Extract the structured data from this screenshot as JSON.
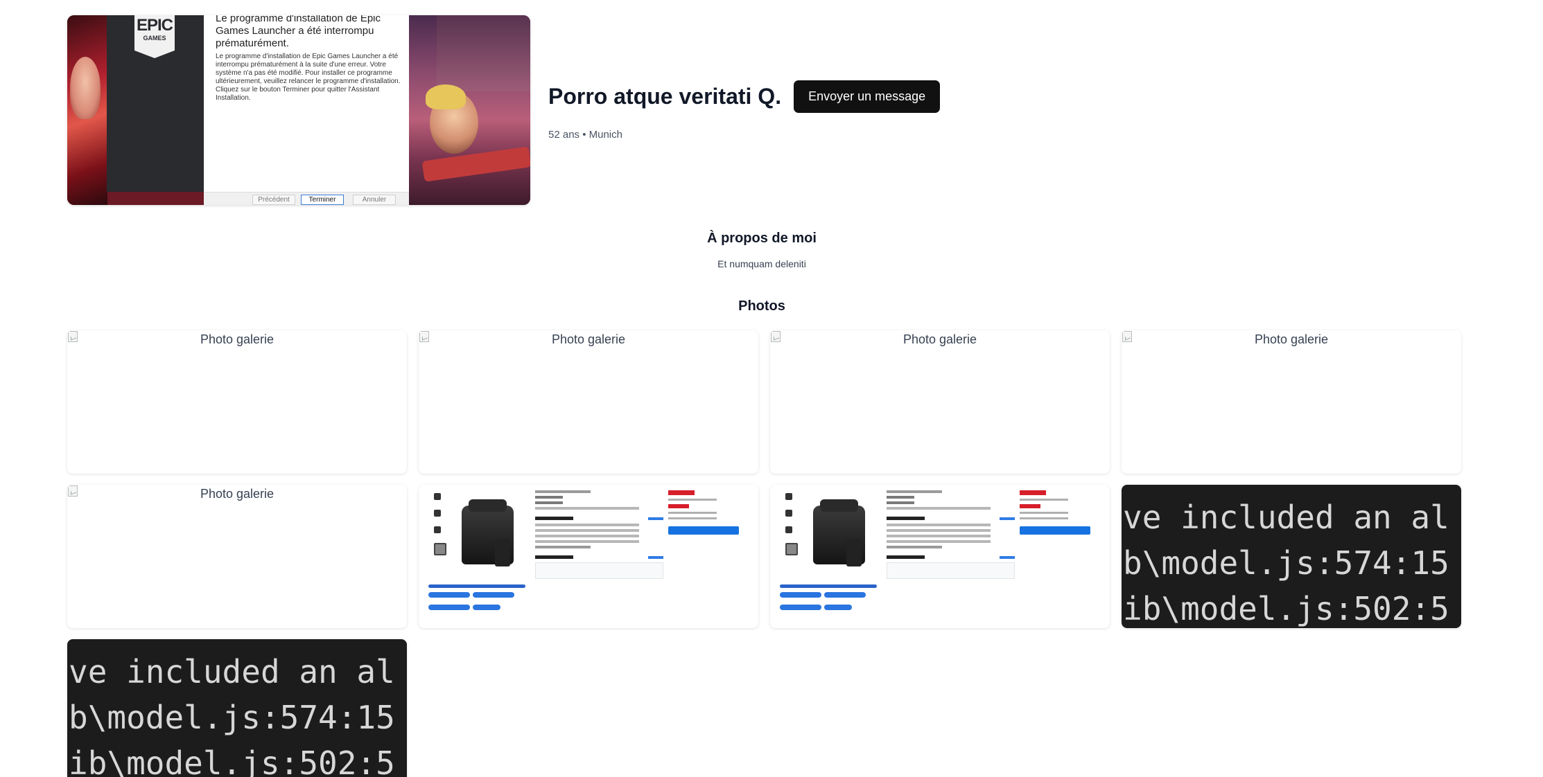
{
  "profile": {
    "name": "Porro atque veritati Q.",
    "meta": "52 ans • Munich",
    "message_button_label": "Envoyer un message",
    "cover_photo": {
      "logo_line1": "EPIC",
      "logo_line2": "GAMES",
      "dialog_title": "Le programme d'installation de Epic Games Launcher a été interrompu prématurément.",
      "dialog_body": "Le programme d'installation de Epic Games Launcher a été interrompu prématurément à la suite d'une erreur. Votre système n'a pas été modifié. Pour installer ce programme ultérieurement, veuillez relancer le programme d'installation. Cliquez sur le bouton Terminer pour quitter l'Assistant Installation.",
      "btn_prev": "Précédent",
      "btn_finish": "Terminer",
      "btn_cancel": "Annuler"
    }
  },
  "about": {
    "title": "À propos de moi",
    "text": "Et numquam deleniti"
  },
  "photos": {
    "title": "Photos",
    "alt_text": "Photo galerie",
    "items": [
      {
        "kind": "broken",
        "alt": "Photo galerie"
      },
      {
        "kind": "broken",
        "alt": "Photo galerie"
      },
      {
        "kind": "broken",
        "alt": "Photo galerie"
      },
      {
        "kind": "broken",
        "alt": "Photo galerie"
      },
      {
        "kind": "broken",
        "alt": "Photo galerie"
      },
      {
        "kind": "product-screenshot"
      },
      {
        "kind": "product-screenshot"
      },
      {
        "kind": "code-screenshot"
      },
      {
        "kind": "code-screenshot"
      }
    ],
    "code_lines": [
      "ve included an al",
      "b\\model.js:574:15",
      "ib\\model.js:502:5"
    ]
  },
  "colors": {
    "button_bg": "#111111",
    "button_text": "#ffffff",
    "text_primary": "#111827",
    "text_muted": "#4b5563",
    "code_bg": "#1c1c1c"
  }
}
